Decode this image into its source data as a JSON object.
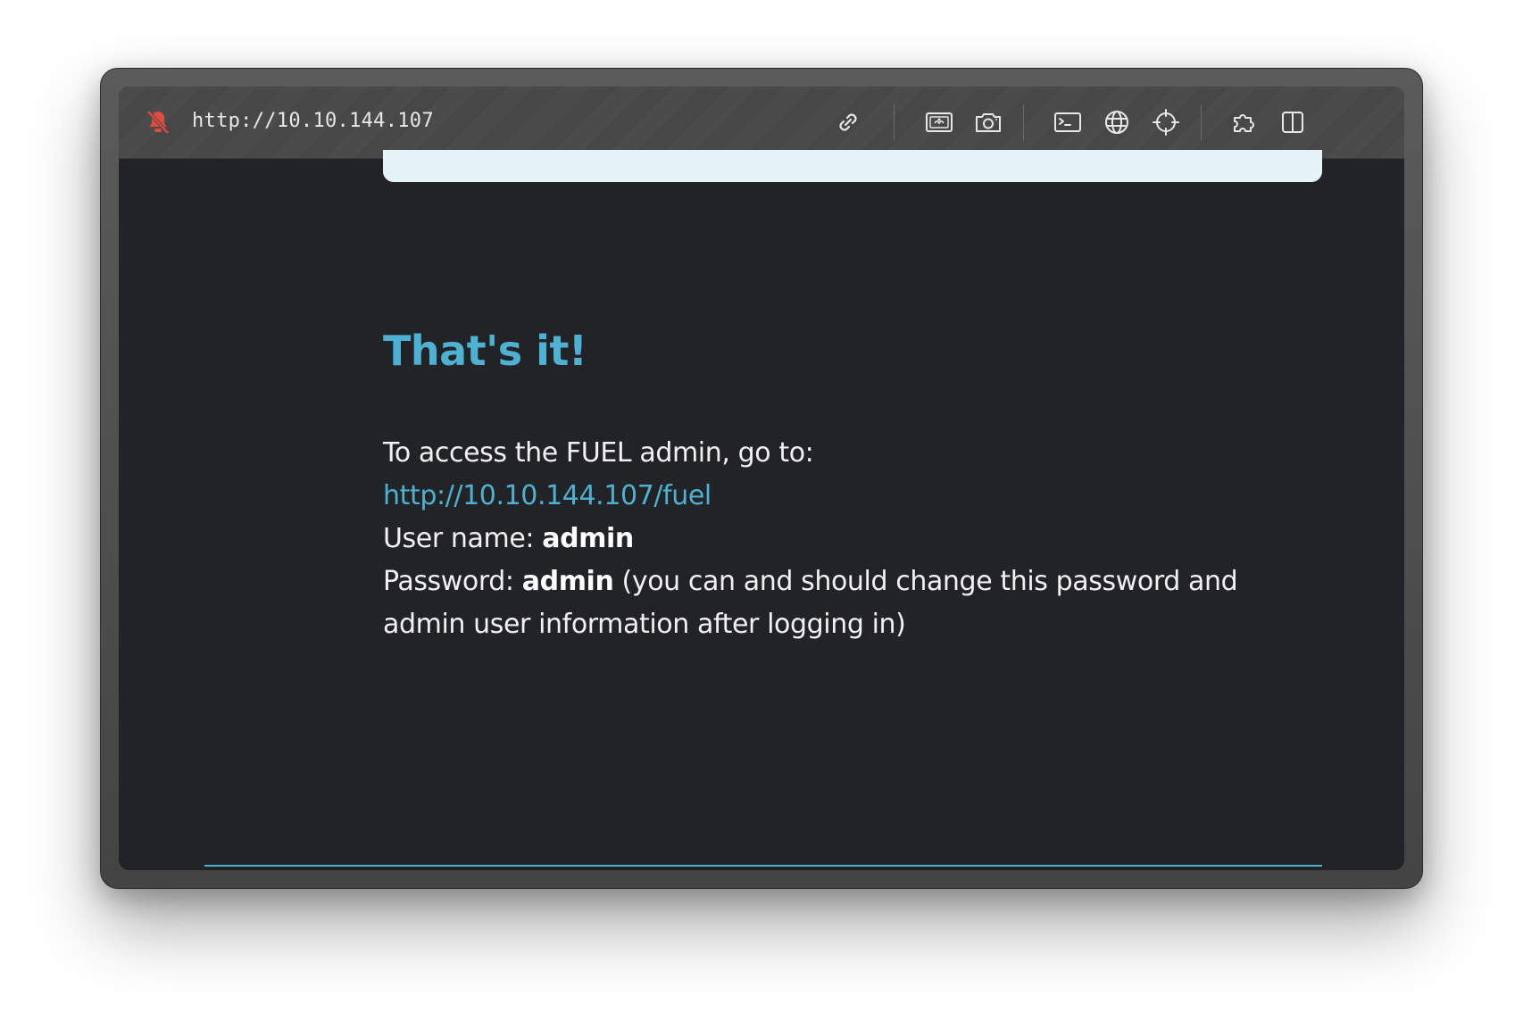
{
  "browser": {
    "url": "http://10.10.144.107",
    "icons": {
      "lock": "lock-slash-icon",
      "link": "link-icon",
      "image": "image-icon",
      "camera": "camera-icon",
      "terminal": "terminal-icon",
      "globe": "globe-icon",
      "target": "crosshair-icon",
      "extension": "puzzle-icon",
      "split": "split-view-icon"
    },
    "colors": {
      "lock_icon": "#e04a3f",
      "accent": "#4fb1d2",
      "background": "#222327"
    }
  },
  "page": {
    "heading": "That's it!",
    "intro": "To access the FUEL admin, go to:",
    "admin_link": "http://10.10.144.107/fuel",
    "username_label": "User name:",
    "username_value": "admin",
    "password_label": "Password:",
    "password_value": "admin",
    "password_note": "(you can and should change this password and admin user information after logging in)"
  }
}
